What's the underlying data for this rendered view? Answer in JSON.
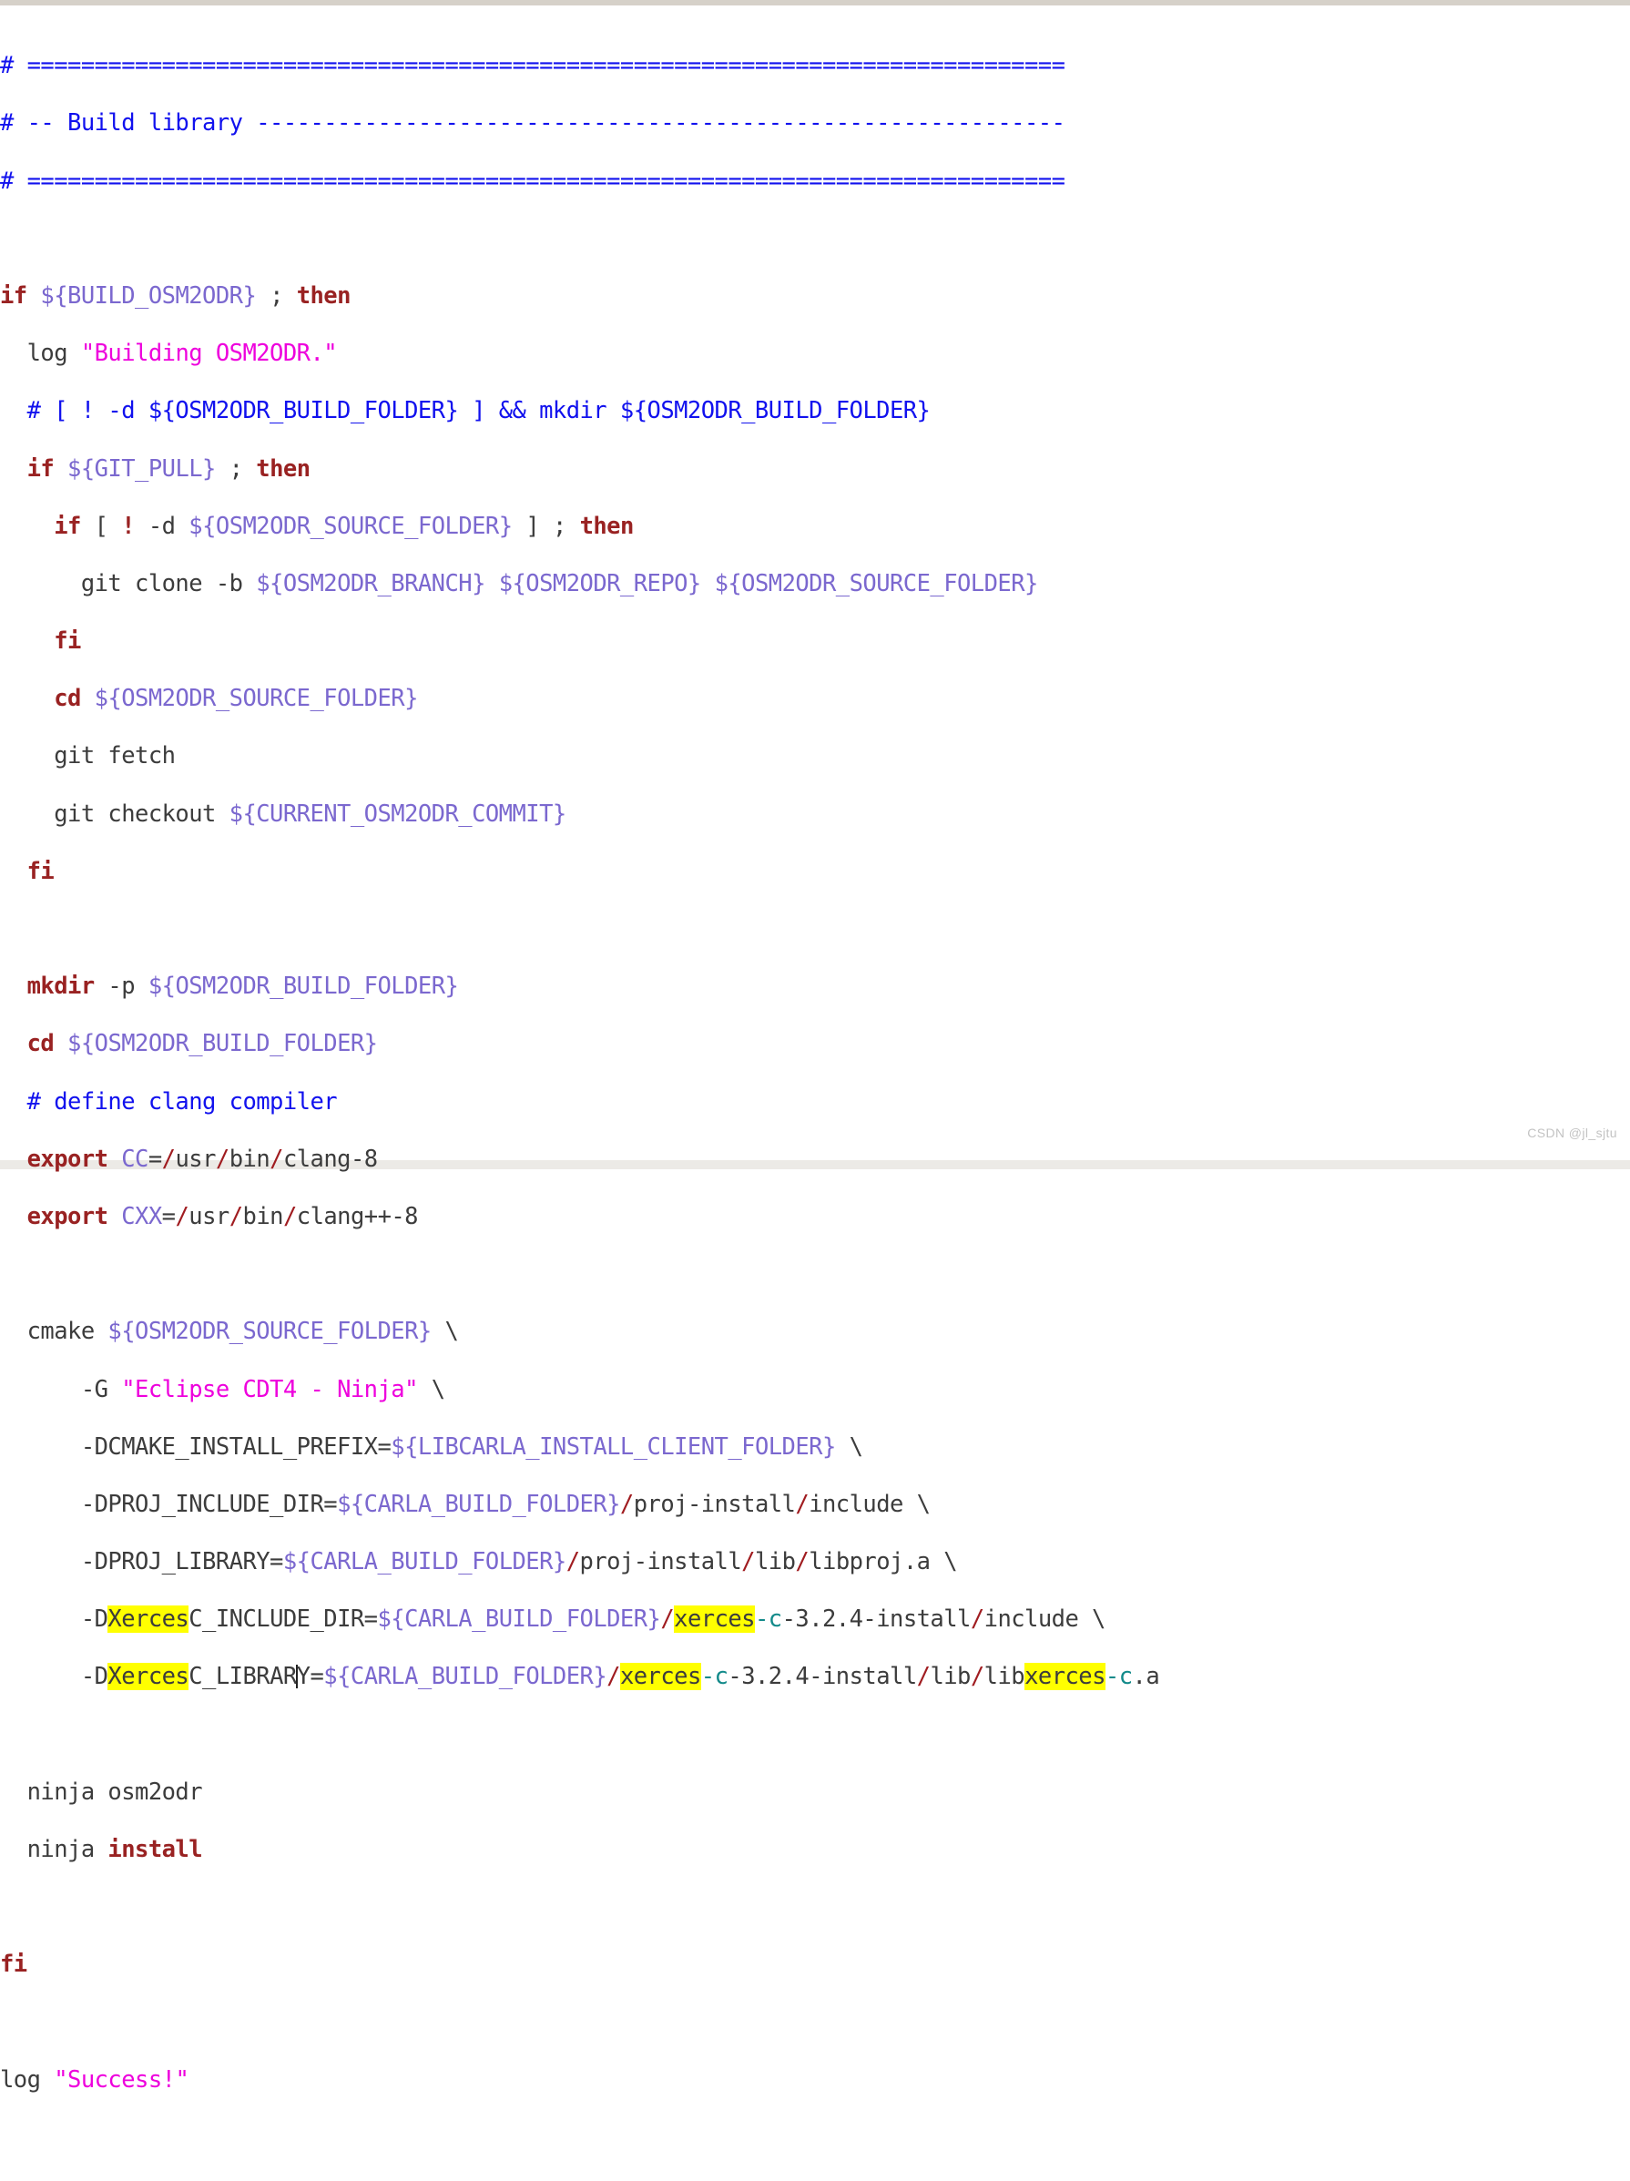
{
  "editor": {
    "language": "bash",
    "watermark": "CSDN @jl_sjtu",
    "colors": {
      "background": "#ffffff",
      "comment": "#1111ee",
      "keyword": "#992222",
      "variable": "#7b68cf",
      "string": "#ee00dd",
      "text": "#3c3c3c",
      "slash": "#a01c20",
      "teal": "#128a8a",
      "highlight": "#ffff00",
      "top_border": "#d6d1c9",
      "bottom_border": "#eceae6"
    },
    "search_highlight_term": "xerces",
    "caret_line": "-DXercesC_LIBRARY"
  },
  "lines": [
    {
      "n": 1,
      "text": "# ============================================================================="
    },
    {
      "n": 2,
      "text": "# -- Build library ------------------------------------------------------------"
    },
    {
      "n": 3,
      "text": "# ============================================================================="
    },
    {
      "n": 4,
      "text": ""
    },
    {
      "n": 5,
      "text": "if ${BUILD_OSM2ODR} ; then"
    },
    {
      "n": 6,
      "text": "  log \"Building OSM2ODR.\""
    },
    {
      "n": 7,
      "text": "  # [ ! -d ${OSM2ODR_BUILD_FOLDER} ] && mkdir ${OSM2ODR_BUILD_FOLDER}"
    },
    {
      "n": 8,
      "text": "  if ${GIT_PULL} ; then"
    },
    {
      "n": 9,
      "text": "    if [ ! -d ${OSM2ODR_SOURCE_FOLDER} ] ; then"
    },
    {
      "n": 10,
      "text": "      git clone -b ${OSM2ODR_BRANCH} ${OSM2ODR_REPO} ${OSM2ODR_SOURCE_FOLDER}"
    },
    {
      "n": 11,
      "text": "    fi"
    },
    {
      "n": 12,
      "text": "    cd ${OSM2ODR_SOURCE_FOLDER}"
    },
    {
      "n": 13,
      "text": "    git fetch"
    },
    {
      "n": 14,
      "text": "    git checkout ${CURRENT_OSM2ODR_COMMIT}"
    },
    {
      "n": 15,
      "text": "  fi"
    },
    {
      "n": 16,
      "text": ""
    },
    {
      "n": 17,
      "text": "  mkdir -p ${OSM2ODR_BUILD_FOLDER}"
    },
    {
      "n": 18,
      "text": "  cd ${OSM2ODR_BUILD_FOLDER}"
    },
    {
      "n": 19,
      "text": "  # define clang compiler"
    },
    {
      "n": 20,
      "text": "  export CC=/usr/bin/clang-8"
    },
    {
      "n": 21,
      "text": "  export CXX=/usr/bin/clang++-8"
    },
    {
      "n": 22,
      "text": ""
    },
    {
      "n": 23,
      "text": "  cmake ${OSM2ODR_SOURCE_FOLDER} \\"
    },
    {
      "n": 24,
      "text": "      -G \"Eclipse CDT4 - Ninja\" \\"
    },
    {
      "n": 25,
      "text": "      -DCMAKE_INSTALL_PREFIX=${LIBCARLA_INSTALL_CLIENT_FOLDER} \\"
    },
    {
      "n": 26,
      "text": "      -DPROJ_INCLUDE_DIR=${CARLA_BUILD_FOLDER}/proj-install/include \\"
    },
    {
      "n": 27,
      "text": "      -DPROJ_LIBRARY=${CARLA_BUILD_FOLDER}/proj-install/lib/libproj.a \\"
    },
    {
      "n": 28,
      "text": "      -DXercesC_INCLUDE_DIR=${CARLA_BUILD_FOLDER}/xerces-c-3.2.4-install/include \\"
    },
    {
      "n": 29,
      "text": "      -DXercesC_LIBRARY=${CARLA_BUILD_FOLDER}/xerces-c-3.2.4-install/lib/libxerces-c.a"
    },
    {
      "n": 30,
      "text": ""
    },
    {
      "n": 31,
      "text": "  ninja osm2odr"
    },
    {
      "n": 32,
      "text": "  ninja install"
    },
    {
      "n": 33,
      "text": ""
    },
    {
      "n": 34,
      "text": "fi"
    },
    {
      "n": 35,
      "text": ""
    },
    {
      "n": 36,
      "text": "log \"Success!\""
    }
  ]
}
